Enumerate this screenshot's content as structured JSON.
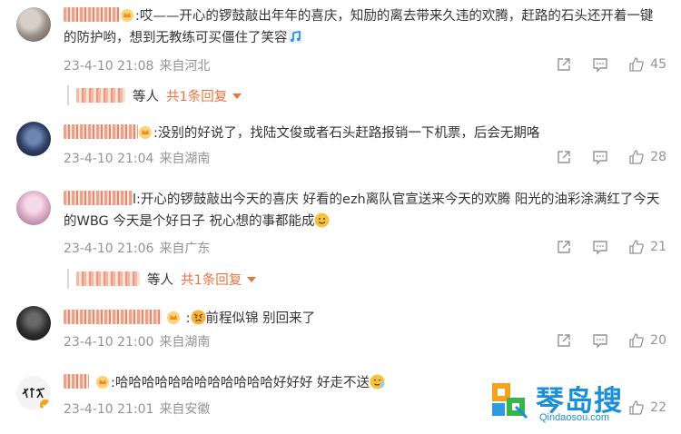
{
  "comments": [
    {
      "text": ":哎——开心的锣鼓敲出年年的喜庆，知励的离去带来久违的欢腾，赶路的石头还开着一键的防护哟，想到无教练可买僵住了笑容",
      "time": "23-4-10 21:08",
      "location": "来自河北",
      "likes": "45"
    },
    {
      "text": ":没别的好说了，找陆文俊或者石头赶路报销一下机票，后会无期咯",
      "time": "23-4-10 21:04",
      "location": "来自湖南",
      "likes": "28"
    },
    {
      "text": "l:开心的锣鼓敲出今天的喜庆 好看的ezh离队官宣送来今天的欢腾 阳光的油彩涂满红了今天的WBG 今天是个好日子 祝心想的事都能成",
      "time": "23-4-10 21:06",
      "location": "来自广东",
      "likes": "21"
    },
    {
      "text": "前程似锦 别回来了",
      "time": "23-4-10 21:00",
      "location": "来自湖南",
      "likes": "20"
    },
    {
      "text": ":哈哈哈哈哈哈哈哈哈哈哈哈好好好 好走不送",
      "time": "23-4-10 21:01",
      "location": "来自安徽",
      "likes": "22"
    }
  ],
  "replies": [
    {
      "deng": "等人",
      "more": "共1条回复"
    },
    {
      "deng": "等人",
      "more": "共1条回复"
    }
  ],
  "watermark": {
    "name": "琴岛搜",
    "domain": "Qindaosou.com"
  },
  "colors": {
    "username": "#eb7340",
    "meta": "#939393",
    "watermark": "#1a8ed8"
  }
}
